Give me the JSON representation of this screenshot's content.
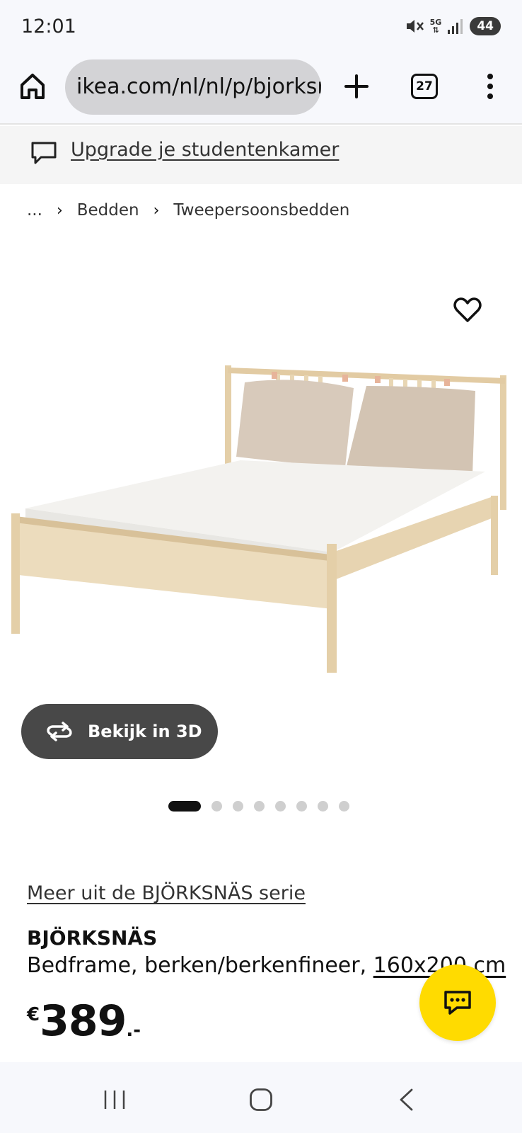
{
  "status_bar": {
    "time": "12:01",
    "network": "5G",
    "battery": "44"
  },
  "browser": {
    "url": "ikea.com/nl/nl/p/bjorksnas-bedframe",
    "tab_count": "27",
    "icons": [
      "home-icon",
      "plus-icon",
      "tabs-icon",
      "more-vert-icon"
    ]
  },
  "promo": {
    "label": "Upgrade je studentenkamer",
    "icon": "chat-bubble-icon"
  },
  "breadcrumb": {
    "items": [
      "...",
      "Bedden",
      "Tweepersoonsbedden"
    ]
  },
  "product": {
    "image_alt": "BJÖRKSNÄS bed",
    "view_3d_label": "Bekijk in 3D",
    "carousel": {
      "total": 8,
      "active": 1
    },
    "series_link": "Meer uit de BJÖRKSNÄS serie",
    "name": "BJÖRKSNÄS",
    "description": "Bedframe, berken/berkenfineer, ",
    "size": "160x200 cm",
    "price": {
      "currency": "€",
      "integer": "389",
      "decimal": ".-"
    }
  },
  "colors": {
    "chat_fab": "#ffdb00",
    "button_3d": "#484848",
    "url_bar": "#d3d3d6"
  }
}
